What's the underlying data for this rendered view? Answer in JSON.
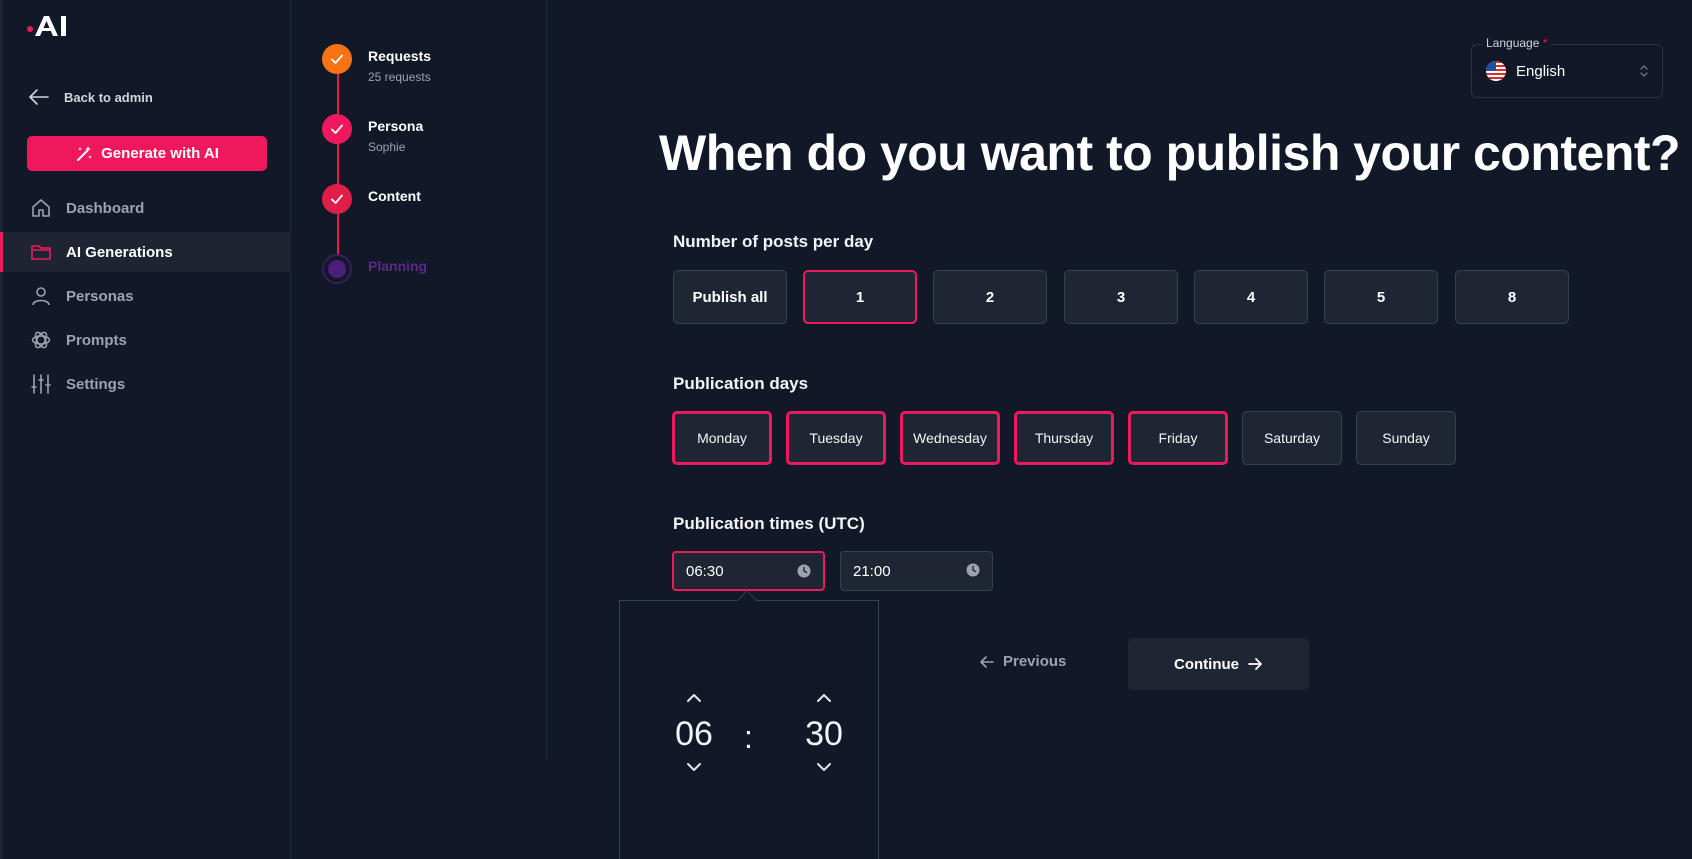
{
  "sidebar": {
    "back_label": "Back to admin",
    "generate_label": "Generate with AI",
    "items": [
      {
        "label": "Dashboard",
        "icon": "home-icon"
      },
      {
        "label": "AI Generations",
        "icon": "folder-icon",
        "active": true
      },
      {
        "label": "Personas",
        "icon": "user-icon"
      },
      {
        "label": "Prompts",
        "icon": "openai-icon"
      },
      {
        "label": "Settings",
        "icon": "sliders-icon"
      }
    ]
  },
  "stepper": {
    "steps": [
      {
        "title": "Requests",
        "sub": "25 requests",
        "status": "done",
        "color": "#f97316"
      },
      {
        "title": "Persona",
        "sub": "Sophie",
        "status": "done",
        "color": "#f0185d"
      },
      {
        "title": "Content",
        "sub": "",
        "status": "done",
        "color": "#e11d48"
      },
      {
        "title": "Planning",
        "sub": "",
        "status": "current",
        "color": "#5b2a86"
      }
    ]
  },
  "language": {
    "label": "Language",
    "required": "*",
    "value": "English"
  },
  "headline": "When do you want to publish your content?",
  "posts": {
    "title": "Number of posts per day",
    "options": [
      "Publish all",
      "1",
      "2",
      "3",
      "4",
      "5",
      "8"
    ],
    "selected": "1"
  },
  "days": {
    "title": "Publication days",
    "options": [
      "Monday",
      "Tuesday",
      "Wednesday",
      "Thursday",
      "Friday",
      "Saturday",
      "Sunday"
    ],
    "selected": [
      "Monday",
      "Tuesday",
      "Wednesday",
      "Thursday",
      "Friday"
    ]
  },
  "times": {
    "title": "Publication times (UTC)",
    "values": [
      "06:30",
      "21:00"
    ]
  },
  "picker": {
    "hours": "06",
    "minutes": "30",
    "separator": ":"
  },
  "nav": {
    "previous": "Previous",
    "continue": "Continue"
  },
  "colors": {
    "accent": "#f0185d",
    "bg": "#111827",
    "surface": "#1f2633"
  }
}
